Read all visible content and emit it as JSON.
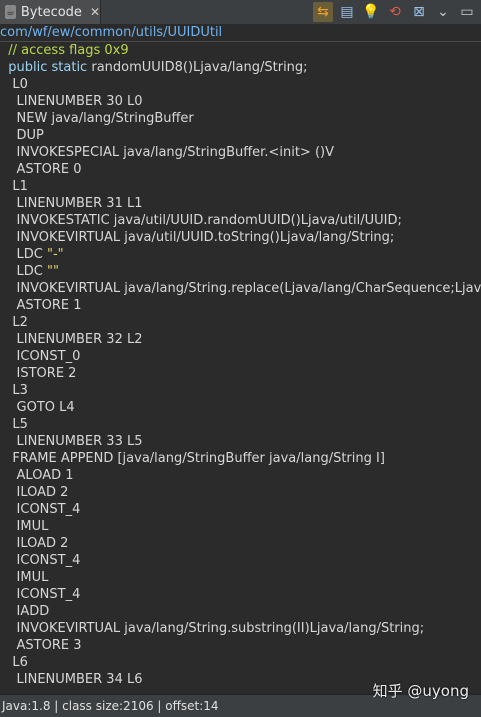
{
  "tab": {
    "title": "Bytecode",
    "close": "✕"
  },
  "toolbar": [
    "link-icon",
    "layout-icon",
    "bulb-icon",
    "recent-icon",
    "pin-icon",
    "minimize-icon",
    "chevron-down-icon"
  ],
  "path": "com/wf/ew/common/utils/UUIDUtil",
  "code": [
    {
      "text": "  // access flags 0x9",
      "cls": "comment"
    },
    {
      "text": "  public static randomUUID8()Ljava/lang/String;",
      "cls": "kwline"
    },
    {
      "text": "   L0",
      "cls": ""
    },
    {
      "text": "    LINENUMBER 30 L0",
      "cls": ""
    },
    {
      "text": "    NEW java/lang/StringBuffer",
      "cls": ""
    },
    {
      "text": "    DUP",
      "cls": ""
    },
    {
      "text": "    INVOKESPECIAL java/lang/StringBuffer.<init> ()V",
      "cls": ""
    },
    {
      "text": "    ASTORE 0",
      "cls": ""
    },
    {
      "text": "   L1",
      "cls": ""
    },
    {
      "text": "    LINENUMBER 31 L1",
      "cls": ""
    },
    {
      "text": "    INVOKESTATIC java/util/UUID.randomUUID()Ljava/util/UUID;",
      "cls": ""
    },
    {
      "text": "    INVOKEVIRTUAL java/util/UUID.toString()Ljava/lang/String;",
      "cls": ""
    },
    {
      "text": "    LDC \"-\"",
      "cls": "ldc"
    },
    {
      "text": "    LDC \"\"",
      "cls": "ldc"
    },
    {
      "text": "    INVOKEVIRTUAL java/lang/String.replace(Ljava/lang/CharSequence;Ljava/lang/",
      "cls": ""
    },
    {
      "text": "    ASTORE 1",
      "cls": ""
    },
    {
      "text": "   L2",
      "cls": ""
    },
    {
      "text": "    LINENUMBER 32 L2",
      "cls": ""
    },
    {
      "text": "    ICONST_0",
      "cls": ""
    },
    {
      "text": "    ISTORE 2",
      "cls": ""
    },
    {
      "text": "   L3",
      "cls": ""
    },
    {
      "text": "    GOTO L4",
      "cls": ""
    },
    {
      "text": "   L5",
      "cls": ""
    },
    {
      "text": "    LINENUMBER 33 L5",
      "cls": ""
    },
    {
      "text": "   FRAME APPEND [java/lang/StringBuffer java/lang/String I]",
      "cls": ""
    },
    {
      "text": "    ALOAD 1",
      "cls": ""
    },
    {
      "text": "    ILOAD 2",
      "cls": ""
    },
    {
      "text": "    ICONST_4",
      "cls": ""
    },
    {
      "text": "    IMUL",
      "cls": ""
    },
    {
      "text": "    ILOAD 2",
      "cls": ""
    },
    {
      "text": "    ICONST_4",
      "cls": ""
    },
    {
      "text": "    IMUL",
      "cls": ""
    },
    {
      "text": "    ICONST_4",
      "cls": ""
    },
    {
      "text": "    IADD",
      "cls": ""
    },
    {
      "text": "    INVOKEVIRTUAL java/lang/String.substring(II)Ljava/lang/String;",
      "cls": ""
    },
    {
      "text": "    ASTORE 3",
      "cls": ""
    },
    {
      "text": "   L6",
      "cls": ""
    },
    {
      "text": "    LINENUMBER 34 L6",
      "cls": ""
    }
  ],
  "status": "Java:1.8 | class size:2106 | offset:14",
  "watermark": "知乎 @uyong"
}
